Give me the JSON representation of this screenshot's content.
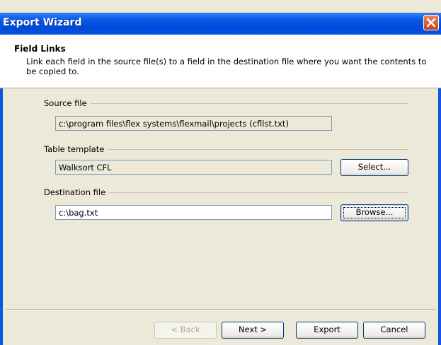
{
  "window": {
    "title": "Export Wizard",
    "close_icon": "close-x-icon"
  },
  "header": {
    "title": "Field Links",
    "description": "Link each field in the source file(s) to a field in the destination file where you want the contents to be copied to."
  },
  "source": {
    "label": "Source file",
    "value": "c:\\program files\\flex systems\\flexmail\\projects (cfllst.txt)"
  },
  "template": {
    "label": "Table template",
    "value": "Walksort CFL",
    "select_label": "Select..."
  },
  "destination": {
    "label": "Destination file",
    "value": "c:\\bag.txt",
    "browse_label": "Browse..."
  },
  "footer": {
    "back_label": "< Back",
    "next_label": "Next >",
    "export_label": "Export",
    "cancel_label": "Cancel"
  },
  "colors": {
    "titlebar": "#0b56e3",
    "dialog_bg": "#ece9d8",
    "close_button": "#d9542c"
  }
}
